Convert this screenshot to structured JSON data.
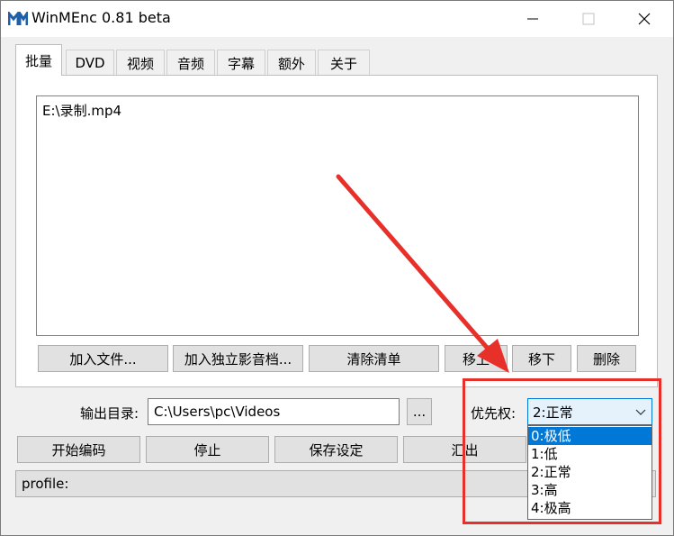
{
  "window": {
    "title": "WinMEnc 0.81 beta"
  },
  "tabs": [
    {
      "label": "批量"
    },
    {
      "label": "DVD"
    },
    {
      "label": "视频"
    },
    {
      "label": "音频"
    },
    {
      "label": "字幕"
    },
    {
      "label": "额外"
    },
    {
      "label": "关于"
    }
  ],
  "file_list": {
    "items": [
      "E:\\录制.mp4"
    ]
  },
  "list_buttons": {
    "add_file": "加入文件...",
    "add_av": "加入独立影音档...",
    "clear": "清除清单",
    "move_up": "移上",
    "move_down": "移下",
    "delete": "删除"
  },
  "output": {
    "label": "输出目录:",
    "value": "C:\\Users\\pc\\Videos",
    "browse": "..."
  },
  "priority": {
    "label": "优先权:",
    "selected": "2:正常",
    "options": [
      "0:极低",
      "1:低",
      "2:正常",
      "3:高",
      "4:极高"
    ],
    "highlighted_index": 0
  },
  "actions": {
    "start": "开始编码",
    "stop": "停止",
    "save": "保存设定",
    "export": "汇出"
  },
  "status": {
    "text": "profile:"
  },
  "colors": {
    "annotation": "#e8302a",
    "highlight": "#0078d7",
    "button": "#e1e1e1"
  },
  "icons": {
    "app": "app-logo-icon",
    "minimize": "minimize-icon",
    "maximize": "maximize-icon",
    "close": "close-icon",
    "dropdown": "chevron-down-icon"
  }
}
